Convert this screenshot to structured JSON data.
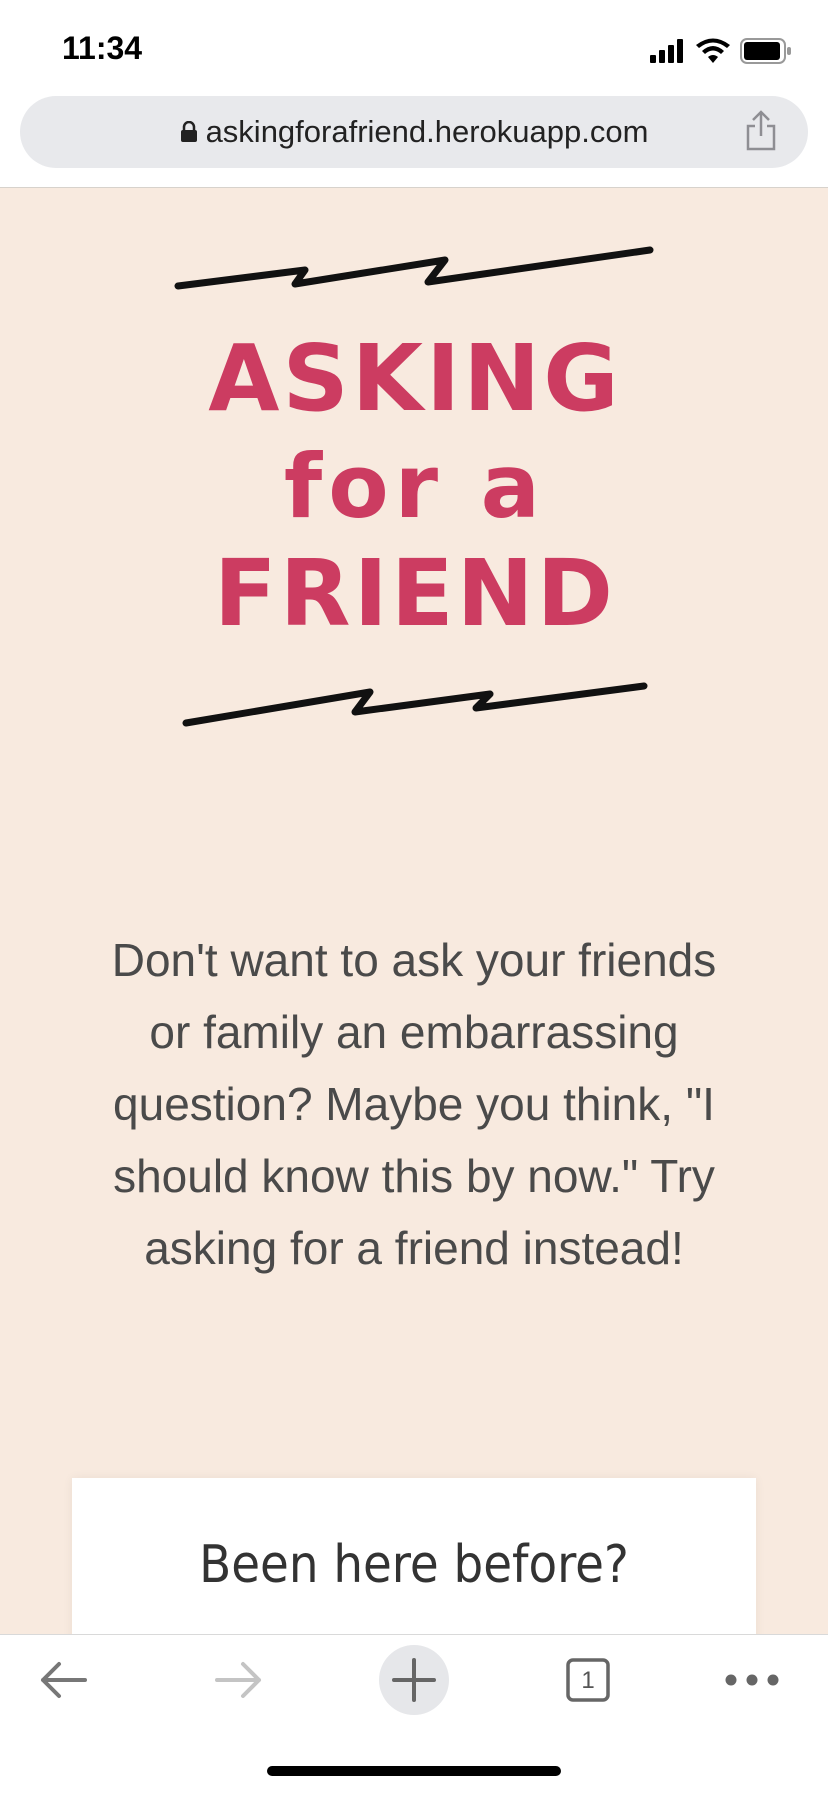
{
  "status_bar": {
    "time": "11:34"
  },
  "browser": {
    "url": "askingforafriend.herokuapp.com",
    "tab_count": "1"
  },
  "page": {
    "logo_lines": [
      "ASKING",
      "for a",
      "FRIEND"
    ],
    "intro": "Don't want to ask your friends or family an embarrassing question? Maybe you think, \"I should know this by now.\" Try asking for a friend instead!",
    "card_title": "Been here before?"
  },
  "colors": {
    "background": "#f8eadf",
    "logo": "#cc3c61",
    "text": "#4a4a4a"
  },
  "icons": {
    "status": [
      "cellular-signal-icon",
      "wifi-icon",
      "battery-icon"
    ],
    "toolbar": [
      "back-arrow-icon",
      "forward-arrow-icon",
      "new-tab-plus-icon",
      "tabs-icon",
      "more-icon"
    ]
  }
}
